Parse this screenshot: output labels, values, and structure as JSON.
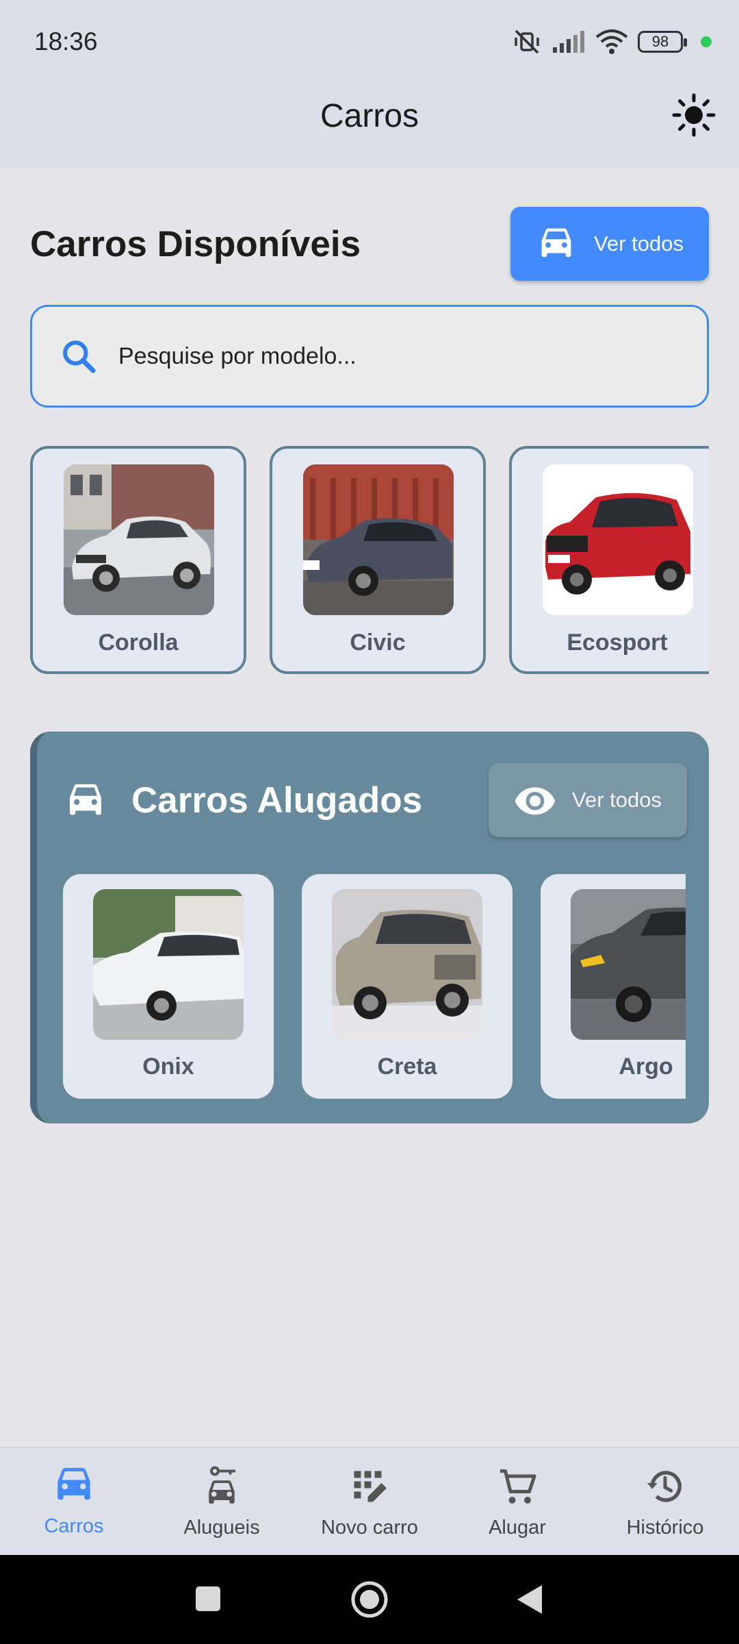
{
  "status_bar": {
    "time": "18:36",
    "battery": "98"
  },
  "app_bar": {
    "title": "Carros",
    "theme_icon": "sun-icon"
  },
  "available": {
    "title": "Carros Disponíveis",
    "see_all_label": "Ver todos",
    "search_placeholder": "Pesquise por modelo...",
    "cars": [
      {
        "name": "Corolla",
        "color": "#d9dbde"
      },
      {
        "name": "Civic",
        "color": "#4a5060"
      },
      {
        "name": "Ecosport",
        "color": "#c8202a"
      }
    ]
  },
  "rented": {
    "title": "Carros Alugados",
    "see_all_label": "Ver todos",
    "cars": [
      {
        "name": "Onix",
        "color": "#e7e8ea"
      },
      {
        "name": "Creta",
        "color": "#a79e92"
      },
      {
        "name": "Argo",
        "color": "#4d4e52"
      }
    ]
  },
  "bottom_nav": {
    "active": "Carros",
    "items": [
      {
        "label": "Carros",
        "icon": "car-icon"
      },
      {
        "label": "Alugueis",
        "icon": "car-rental-icon"
      },
      {
        "label": "Novo carro",
        "icon": "add-car-icon"
      },
      {
        "label": "Alugar",
        "icon": "cart-icon"
      },
      {
        "label": "Histórico",
        "icon": "history-icon"
      }
    ]
  },
  "colors": {
    "accent": "#448aff",
    "panel": "#668a9c",
    "card_border": "#5f8294"
  }
}
